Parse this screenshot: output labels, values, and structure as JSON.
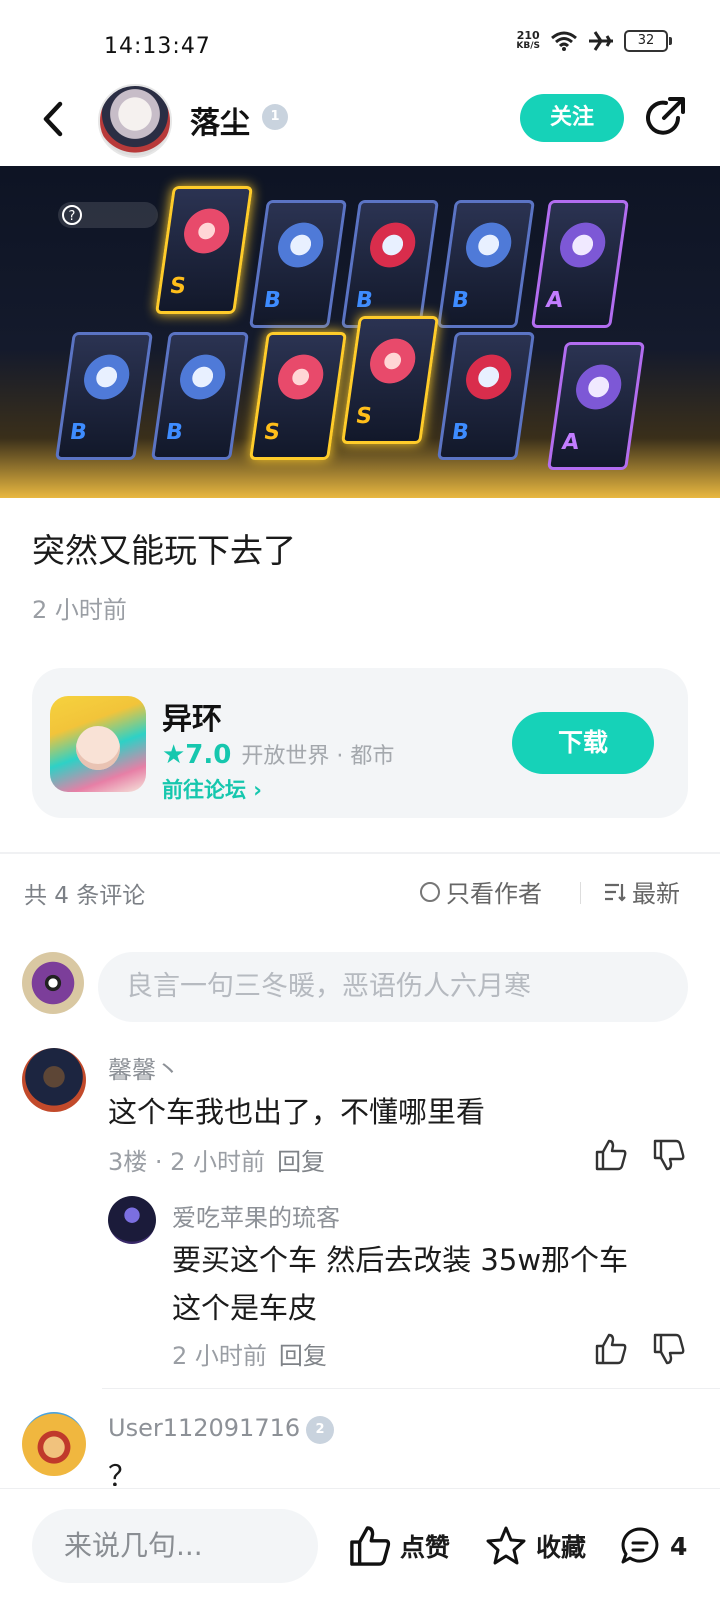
{
  "status_bar": {
    "time": "14:13:47",
    "net_speed_value": "210",
    "net_speed_unit": "KB/S",
    "battery": "32"
  },
  "header": {
    "author_name": "落尘",
    "level_badge": "1",
    "follow_label": "关注"
  },
  "banner": {
    "cards": [
      {
        "rank": "S",
        "style": "gold"
      },
      {
        "rank": "B",
        "style": "blue"
      },
      {
        "rank": "B",
        "style": "red"
      },
      {
        "rank": "B",
        "style": "blue"
      },
      {
        "rank": "A",
        "style": "purple"
      },
      {
        "rank": "B",
        "style": "blue"
      },
      {
        "rank": "B",
        "style": "blue"
      },
      {
        "rank": "S",
        "style": "gold"
      },
      {
        "rank": "S",
        "style": "gold"
      },
      {
        "rank": "B",
        "style": "red"
      },
      {
        "rank": "A",
        "style": "purple"
      }
    ]
  },
  "post": {
    "title": "突然又能玩下去了",
    "time": "2 小时前"
  },
  "game": {
    "name": "异环",
    "rating": "★7.0",
    "genre": "开放世界 · 都市",
    "forum_link": "前往论坛 ›",
    "download_label": "下载"
  },
  "comments_header": {
    "count": "共 4 条评论",
    "author_only": "只看作者",
    "sort": "最新"
  },
  "comment_input": {
    "placeholder": "良言一句三冬暖，恶语伤人六月寒"
  },
  "comments": [
    {
      "name": "馨馨丶",
      "text": "这个车我也出了，不懂哪里看",
      "meta": "3楼 · 2 小时前",
      "reply": "回复"
    },
    {
      "name": "爱吃苹果的琉客",
      "text_line1": "要买这个车 然后去改装 35w那个车",
      "text_line2": "这个是车皮",
      "meta": "2 小时前",
      "reply": "回复"
    },
    {
      "name": "User112091716",
      "level_badge": "2",
      "text": "？"
    }
  ],
  "bottom_bar": {
    "input_placeholder": "来说几句...",
    "like_label": "点赞",
    "favorite_label": "收藏",
    "comment_count": "4"
  },
  "colors": {
    "accent": "#16d2b8",
    "accent_text": "#16c7ae",
    "muted": "#9a9ea4",
    "card_bg": "#f3f5f7"
  }
}
